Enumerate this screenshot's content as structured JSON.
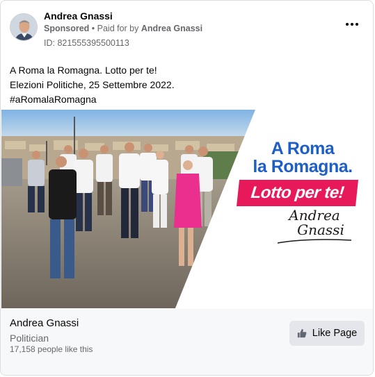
{
  "post": {
    "page_name": "Andrea Gnassi",
    "sponsored_label": "Sponsored",
    "separator": " • ",
    "paid_for_prefix": "Paid for by ",
    "paid_for_name": "Andrea Gnassi",
    "ad_id": "ID: 821555395500113",
    "text_lines": [
      "A Roma la Romagna. Lotto per te!",
      "Elezioni Politiche, 25 Settembre 2022.",
      "#aRomalaRomagna"
    ]
  },
  "creative": {
    "headline_line1": "A Roma",
    "headline_line2": "la Romagna.",
    "slogan": "Lotto per te!",
    "signature_first": "Andrea",
    "signature_last": "Gnassi",
    "colors": {
      "headline_blue": "#1d5fc7",
      "slogan_pink": "#e8195b",
      "signature_dark": "#1a1a1a"
    }
  },
  "footer": {
    "page_name": "Andrea Gnassi",
    "category": "Politician",
    "likes": "17,158 people like this",
    "like_button_label": "Like Page"
  },
  "icons": {
    "more": "more-horizontal-icon",
    "like": "thumbs-up-icon"
  }
}
